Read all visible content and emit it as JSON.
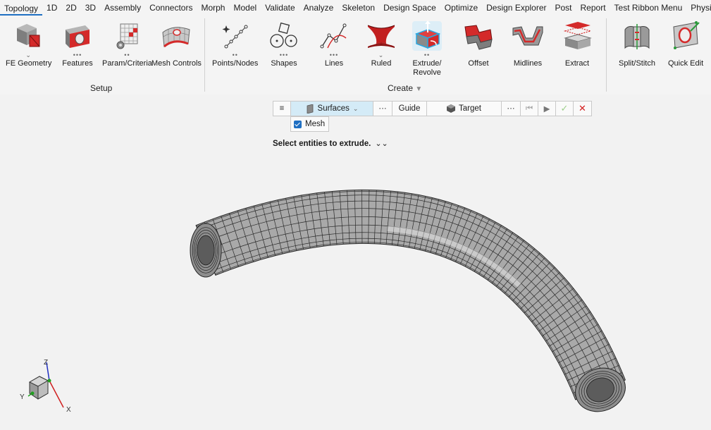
{
  "menu": [
    "Topology",
    "1D",
    "2D",
    "3D",
    "Assembly",
    "Connectors",
    "Morph",
    "Model",
    "Validate",
    "Analyze",
    "Skeleton",
    "Design Space",
    "Optimize",
    "Design Explorer",
    "Post",
    "Report",
    "Test Ribbon Menu",
    "PhysicsAI"
  ],
  "ribbon": {
    "setup": {
      "label": "Setup",
      "tools": [
        {
          "label": "FE Geometry",
          "dots": "⌄"
        },
        {
          "label": "Features",
          "dots": "•••"
        },
        {
          "label": "Param/Criteria",
          "dots": "••"
        },
        {
          "label": "Mesh Controls",
          "dots": ""
        }
      ]
    },
    "create": {
      "label": "Create",
      "tools": [
        {
          "label": "Points/Nodes",
          "dots": "••"
        },
        {
          "label": "Shapes",
          "dots": "•••"
        },
        {
          "label": "Lines",
          "dots": "•••"
        },
        {
          "label": "Ruled",
          "dots": "⌄"
        },
        {
          "label": "Extrude/",
          "label2": "Revolve",
          "dots": "••"
        },
        {
          "label": "Offset",
          "dots": ""
        },
        {
          "label": "Midlines",
          "dots": ""
        },
        {
          "label": "Extract",
          "dots": ""
        }
      ]
    },
    "edit": {
      "tools": [
        {
          "label": "Split/Stitch",
          "dots": ""
        },
        {
          "label": "Quick Edit",
          "dots": ""
        }
      ]
    }
  },
  "guidebar": {
    "menu_icon": "≡",
    "surfaces": "Surfaces",
    "more1": "···",
    "guide": "Guide",
    "target": "Target",
    "more2": "···",
    "mesh": "Mesh"
  },
  "prompt": "Select entities to extrude.",
  "triad": {
    "z": "Z",
    "y": "Y",
    "x": "X"
  },
  "colors": {
    "accent": "#1f6fc2",
    "red_tool": "#d42a2a",
    "cancel": "#d42020",
    "confirm": "#5aa33c"
  }
}
